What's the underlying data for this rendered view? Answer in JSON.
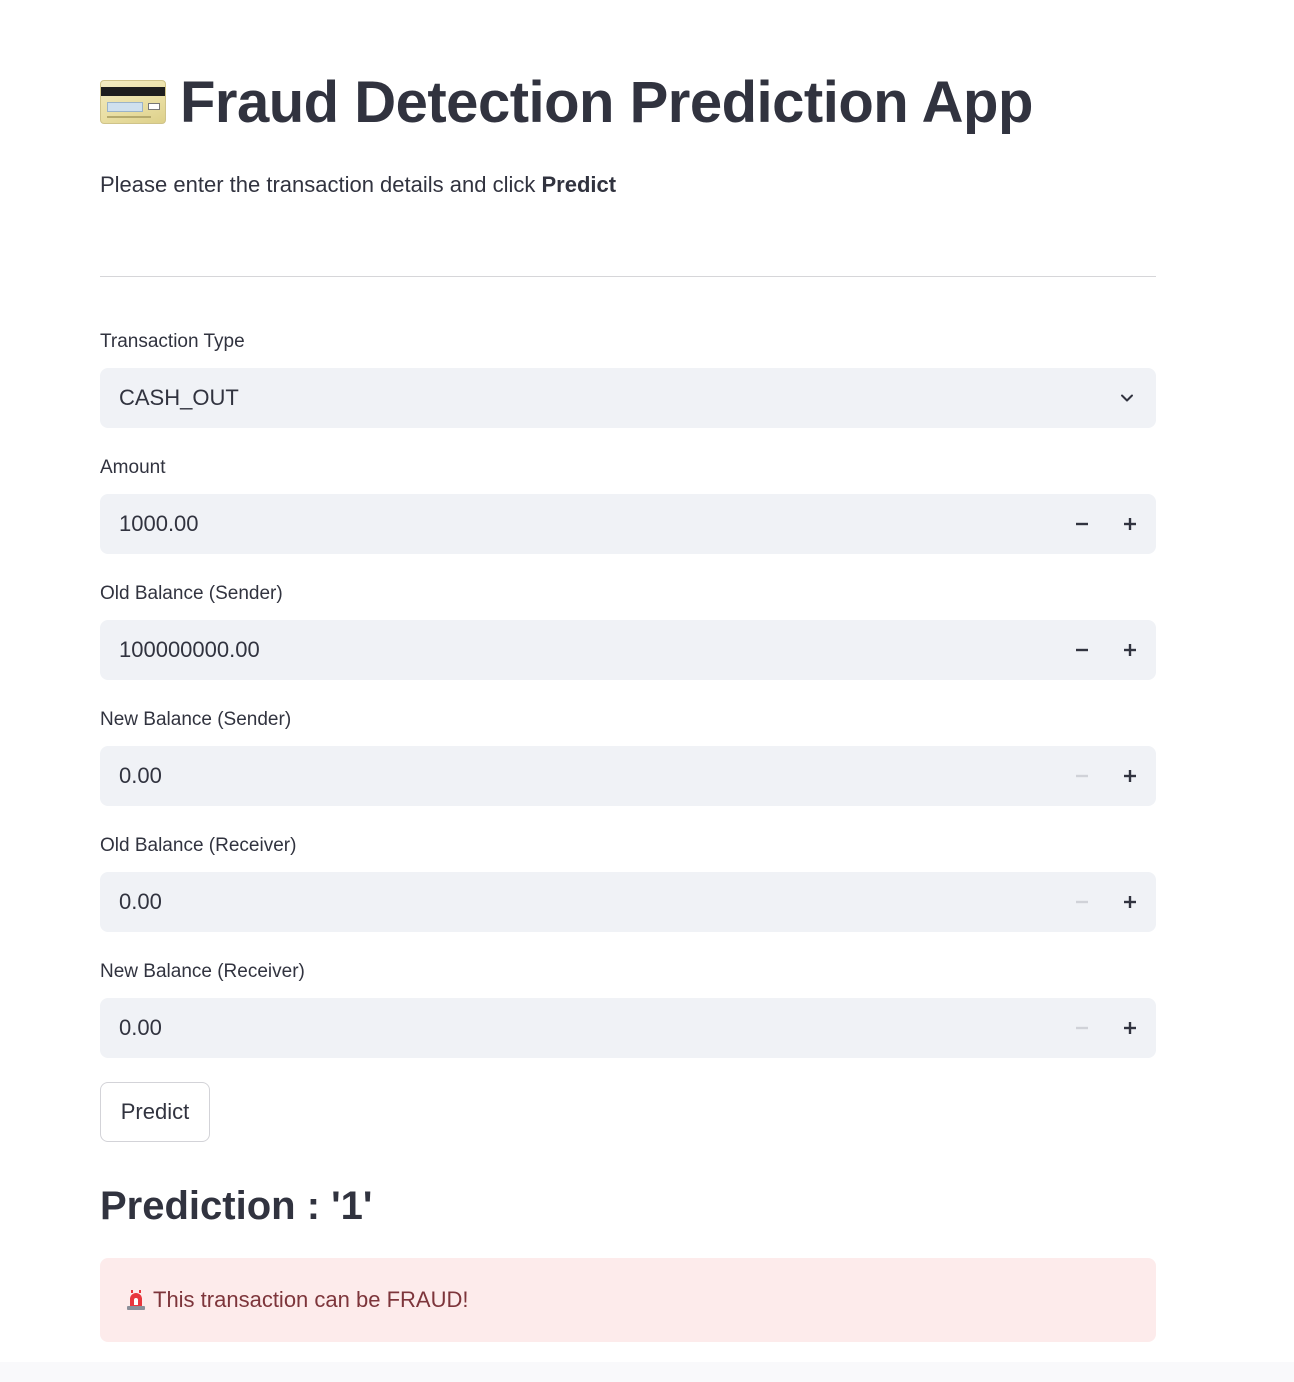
{
  "header": {
    "icon": "credit-card-icon",
    "title": "Fraud Detection Prediction App",
    "subtitle_prefix": "Please enter the transaction details and click ",
    "subtitle_bold": "Predict"
  },
  "form": {
    "transaction_type": {
      "label": "Transaction Type",
      "value": "CASH_OUT"
    },
    "amount": {
      "label": "Amount",
      "value": "1000.00"
    },
    "old_balance_sender": {
      "label": "Old Balance (Sender)",
      "value": "100000000.00"
    },
    "new_balance_sender": {
      "label": "New Balance (Sender)",
      "value": "0.00"
    },
    "old_balance_receiver": {
      "label": "Old Balance (Receiver)",
      "value": "0.00"
    },
    "new_balance_receiver": {
      "label": "New Balance (Receiver)",
      "value": "0.00"
    }
  },
  "predict_button": {
    "label": "Predict"
  },
  "result": {
    "prediction": "Prediction : '1'",
    "alert_icon": "rotating-light-icon",
    "alert_text": "This transaction can be FRAUD!"
  },
  "colors": {
    "text": "#31333f",
    "input_bg": "#f0f2f6",
    "alert_bg": "#fdebeb",
    "alert_text": "#7d353b",
    "disabled_minus": "#d0d2d8"
  }
}
